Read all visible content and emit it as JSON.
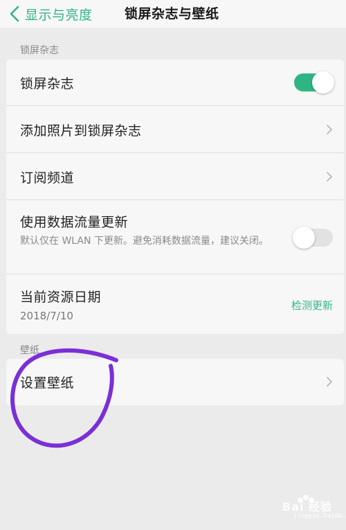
{
  "header": {
    "back_label": "显示与亮度",
    "title": "锁屏杂志与壁纸"
  },
  "sections": {
    "magazine": {
      "label": "锁屏杂志",
      "rows": {
        "magazine_toggle": {
          "title": "锁屏杂志",
          "enabled": true
        },
        "add_photos": {
          "title": "添加照片到锁屏杂志"
        },
        "subscribe": {
          "title": "订阅频道"
        },
        "mobile_data": {
          "title": "使用数据流量更新",
          "subtitle": "默认仅在 WLAN 下更新。避免消耗数据流量，建议关闭。",
          "enabled": false
        },
        "resource_date": {
          "title": "当前资源日期",
          "date": "2018/7/10",
          "action": "检测更新"
        }
      }
    },
    "wallpaper": {
      "label": "壁纸",
      "rows": {
        "set_wallpaper": {
          "title": "设置壁纸"
        }
      }
    }
  },
  "colors": {
    "accent": "#2fb583",
    "annotation": "#7b2fd6"
  },
  "watermark": {
    "text": "Bai 经验",
    "sub": "jingyan.baidu.com"
  }
}
